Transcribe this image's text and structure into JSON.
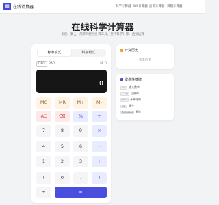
{
  "header": {
    "logo_glyph": "▦",
    "brand": "在线计算器",
    "nav": [
      "科学计算器",
      "BMI计算器",
      "房贷计算器",
      "日期计算器"
    ]
  },
  "hero": {
    "title": "在线科学计算器",
    "subtitle": "免费、安全、简单的在线计算工具，支持科学计算、函数运算"
  },
  "calculator": {
    "modes": [
      "标准模式",
      "科学模式"
    ],
    "active_mode": 0,
    "angle_units": [
      "DEG",
      "RAD"
    ],
    "active_angle": 0,
    "memory_indicator": "M: 0",
    "display": {
      "expression": "",
      "result": "0"
    },
    "keys": [
      [
        {
          "label": "MC",
          "type": "mem"
        },
        {
          "label": "MR",
          "type": "mem"
        },
        {
          "label": "M+",
          "type": "mem"
        },
        {
          "label": "M-",
          "type": "mem"
        }
      ],
      [
        {
          "label": "AC",
          "type": "fn"
        },
        {
          "label": "⌫",
          "type": "fn"
        },
        {
          "label": "%",
          "type": "op"
        },
        {
          "label": "÷",
          "type": "op"
        }
      ],
      [
        {
          "label": "7",
          "type": "num"
        },
        {
          "label": "8",
          "type": "num"
        },
        {
          "label": "9",
          "type": "num"
        },
        {
          "label": "×",
          "type": "op"
        }
      ],
      [
        {
          "label": "4",
          "type": "num"
        },
        {
          "label": "5",
          "type": "num"
        },
        {
          "label": "6",
          "type": "num"
        },
        {
          "label": "−",
          "type": "op"
        }
      ],
      [
        {
          "label": "1",
          "type": "num"
        },
        {
          "label": "2",
          "type": "num"
        },
        {
          "label": "3",
          "type": "num"
        },
        {
          "label": "+",
          "type": "op"
        }
      ],
      [
        {
          "label": "(",
          "type": "num"
        },
        {
          "label": "0",
          "type": "num"
        },
        {
          "label": ".",
          "type": "num"
        },
        {
          "label": ")",
          "type": "op"
        }
      ],
      [
        {
          "label": "±",
          "type": "num"
        },
        {
          "label": "=",
          "type": "eq"
        }
      ]
    ]
  },
  "history": {
    "title": "计算历史",
    "empty_text": "暂无历史"
  },
  "shortcuts": {
    "title": "键盘快捷键",
    "items": [
      {
        "key": "0-9",
        "desc": "输入数字"
      },
      {
        "key": "+ - * /",
        "desc": "运算符"
      },
      {
        "key": "Enter",
        "desc": "计算结果"
      },
      {
        "key": "Esc",
        "desc": "清空"
      },
      {
        "key": "Backspace",
        "desc": "删除"
      }
    ]
  },
  "colors": {
    "accent": "#4a4ede",
    "display_bg": "#161616",
    "history_icon": "#f0a030",
    "shortcut_icon": "#4a54d0"
  }
}
